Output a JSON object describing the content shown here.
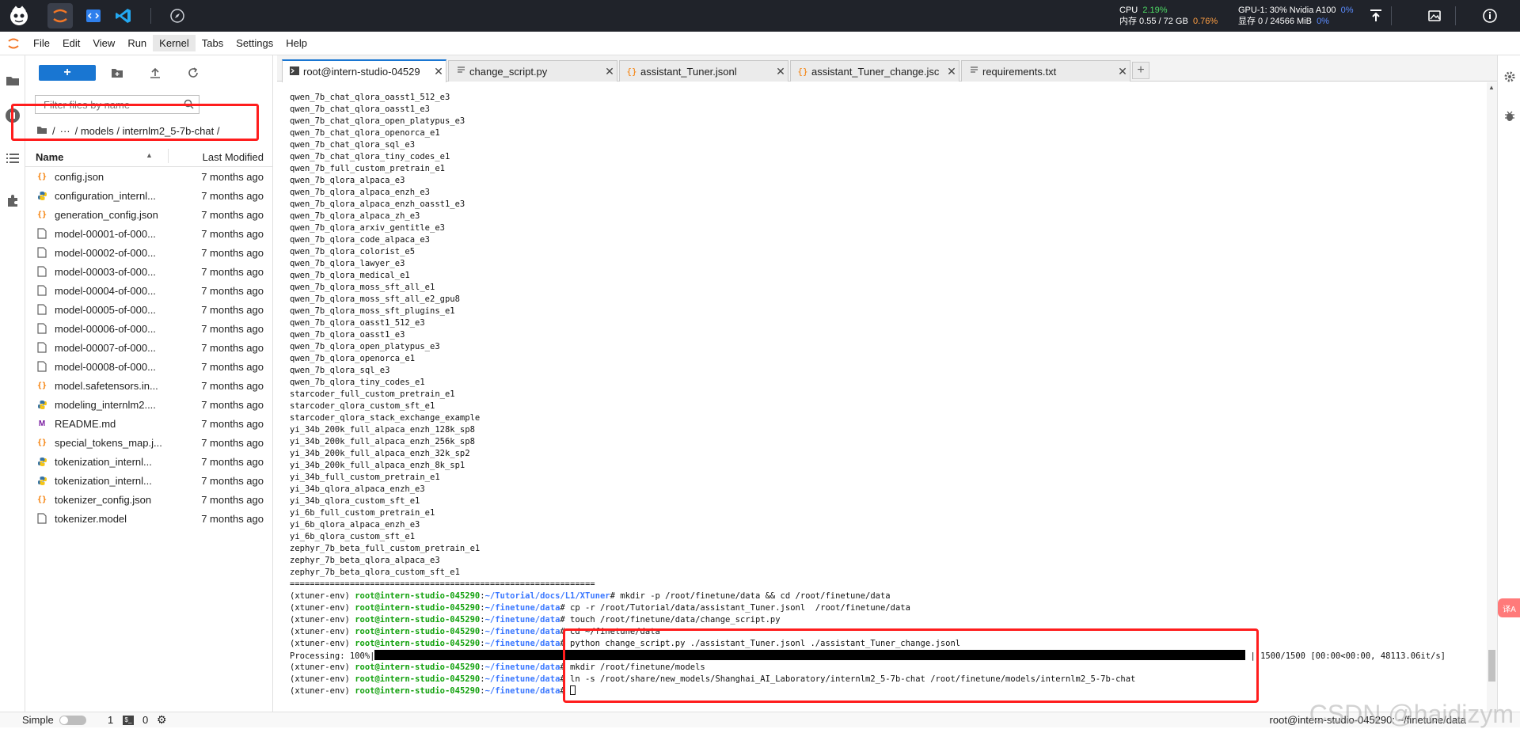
{
  "topbar": {
    "cpu_label": "CPU",
    "cpu_value": "2.19%",
    "mem_label": "内存 0.55 / 72 GB",
    "mem_value": "0.76%",
    "gpu_label": "GPU-1: 30% Nvidia A100",
    "gpu_value": "0%",
    "vram_label": "显存 0 / 24566 MiB",
    "vram_value": "0%",
    "colors": {
      "green": "#4cd964",
      "orange": "#ff9f43",
      "blue": "#5b8cff"
    }
  },
  "menu": {
    "items": [
      "File",
      "Edit",
      "View",
      "Run",
      "Kernel",
      "Tabs",
      "Settings",
      "Help"
    ],
    "active": "Kernel"
  },
  "filebrowser": {
    "new_label": "+",
    "search_placeholder": "Filter files by name",
    "breadcrumb": [
      "/",
      "···",
      "/ models / internlm2_5-7b-chat /"
    ],
    "header_name": "Name",
    "header_modified": "Last Modified",
    "files": [
      {
        "name": "config.json",
        "icon": "json-icon",
        "modified": "7 months ago"
      },
      {
        "name": "configuration_internl...",
        "icon": "python-icon",
        "modified": "7 months ago"
      },
      {
        "name": "generation_config.json",
        "icon": "json-icon",
        "modified": "7 months ago"
      },
      {
        "name": "model-00001-of-000...",
        "icon": "file-icon",
        "modified": "7 months ago"
      },
      {
        "name": "model-00002-of-000...",
        "icon": "file-icon",
        "modified": "7 months ago"
      },
      {
        "name": "model-00003-of-000...",
        "icon": "file-icon",
        "modified": "7 months ago"
      },
      {
        "name": "model-00004-of-000...",
        "icon": "file-icon",
        "modified": "7 months ago"
      },
      {
        "name": "model-00005-of-000...",
        "icon": "file-icon",
        "modified": "7 months ago"
      },
      {
        "name": "model-00006-of-000...",
        "icon": "file-icon",
        "modified": "7 months ago"
      },
      {
        "name": "model-00007-of-000...",
        "icon": "file-icon",
        "modified": "7 months ago"
      },
      {
        "name": "model-00008-of-000...",
        "icon": "file-icon",
        "modified": "7 months ago"
      },
      {
        "name": "model.safetensors.in...",
        "icon": "json-icon",
        "modified": "7 months ago"
      },
      {
        "name": "modeling_internlm2....",
        "icon": "python-icon",
        "modified": "7 months ago"
      },
      {
        "name": "README.md",
        "icon": "markdown-icon",
        "modified": "7 months ago"
      },
      {
        "name": "special_tokens_map.j...",
        "icon": "json-icon",
        "modified": "7 months ago"
      },
      {
        "name": "tokenization_internl...",
        "icon": "python-icon",
        "modified": "7 months ago"
      },
      {
        "name": "tokenization_internl...",
        "icon": "python-icon",
        "modified": "7 months ago"
      },
      {
        "name": "tokenizer_config.json",
        "icon": "json-icon",
        "modified": "7 months ago"
      },
      {
        "name": "tokenizer.model",
        "icon": "file-icon",
        "modified": "7 months ago"
      }
    ]
  },
  "tabs": [
    {
      "label": "root@intern-studio-04529",
      "icon": "terminal-icon",
      "active": true
    },
    {
      "label": "change_script.py",
      "icon": "text-icon",
      "active": false
    },
    {
      "label": "assistant_Tuner.jsonl",
      "icon": "json-icon",
      "active": false
    },
    {
      "label": "assistant_Tuner_change.jsc",
      "icon": "json-icon",
      "active": false
    },
    {
      "label": "requirements.txt",
      "icon": "text-icon",
      "active": false
    }
  ],
  "terminal": {
    "plain_lines": [
      "qwen_7b_chat_qlora_oasst1_512_e3",
      "qwen_7b_chat_qlora_oasst1_e3",
      "qwen_7b_chat_qlora_open_platypus_e3",
      "qwen_7b_chat_qlora_openorca_e1",
      "qwen_7b_chat_qlora_sql_e3",
      "qwen_7b_chat_qlora_tiny_codes_e1",
      "qwen_7b_full_custom_pretrain_e1",
      "qwen_7b_qlora_alpaca_e3",
      "qwen_7b_qlora_alpaca_enzh_e3",
      "qwen_7b_qlora_alpaca_enzh_oasst1_e3",
      "qwen_7b_qlora_alpaca_zh_e3",
      "qwen_7b_qlora_arxiv_gentitle_e3",
      "qwen_7b_qlora_code_alpaca_e3",
      "qwen_7b_qlora_colorist_e5",
      "qwen_7b_qlora_lawyer_e3",
      "qwen_7b_qlora_medical_e1",
      "qwen_7b_qlora_moss_sft_all_e1",
      "qwen_7b_qlora_moss_sft_all_e2_gpu8",
      "qwen_7b_qlora_moss_sft_plugins_e1",
      "qwen_7b_qlora_oasst1_512_e3",
      "qwen_7b_qlora_oasst1_e3",
      "qwen_7b_qlora_open_platypus_e3",
      "qwen_7b_qlora_openorca_e1",
      "qwen_7b_qlora_sql_e3",
      "qwen_7b_qlora_tiny_codes_e1",
      "starcoder_full_custom_pretrain_e1",
      "starcoder_qlora_custom_sft_e1",
      "starcoder_qlora_stack_exchange_example",
      "yi_34b_200k_full_alpaca_enzh_128k_sp8",
      "yi_34b_200k_full_alpaca_enzh_256k_sp8",
      "yi_34b_200k_full_alpaca_enzh_32k_sp2",
      "yi_34b_200k_full_alpaca_enzh_8k_sp1",
      "yi_34b_full_custom_pretrain_e1",
      "yi_34b_qlora_alpaca_enzh_e3",
      "yi_34b_qlora_custom_sft_e1",
      "yi_6b_full_custom_pretrain_e1",
      "yi_6b_qlora_alpaca_enzh_e3",
      "yi_6b_qlora_custom_sft_e1",
      "zephyr_7b_beta_full_custom_pretrain_e1",
      "zephyr_7b_beta_qlora_alpaca_e3",
      "zephyr_7b_beta_qlora_custom_sft_e1",
      "============================================================="
    ],
    "env": "(xtuner-env) ",
    "user": "root@intern-studio-045290",
    "commands": [
      {
        "path": "~/Tutorial/docs/L1/XTuner",
        "cmd": "mkdir -p /root/finetune/data && cd /root/finetune/data"
      },
      {
        "path": "~/finetune/data",
        "cmd": "cp -r /root/Tutorial/data/assistant_Tuner.jsonl  /root/finetune/data"
      },
      {
        "path": "~/finetune/data",
        "cmd": "touch /root/finetune/data/change_script.py"
      },
      {
        "path": "~/finetune/data",
        "cmd": "cd ~/finetune/data"
      },
      {
        "path": "~/finetune/data",
        "cmd": "python change_script.py ./assistant_Tuner.jsonl ./assistant_Tuner_change.jsonl"
      }
    ],
    "progress_prefix": "Processing: 100%|",
    "progress_suffix": "| 1500/1500 [00:00<00:00, 48113.06it/s]",
    "progress_fraction": 1.0,
    "commands_after": [
      {
        "path": "~/finetune/data",
        "cmd": "mkdir /root/finetune/models"
      },
      {
        "path": "~/finetune/data",
        "cmd": "ln -s /root/share/new_models/Shanghai_AI_Laboratory/internlm2_5-7b-chat /root/finetune/models/internlm2_5-7b-chat"
      }
    ],
    "last_prompt_path": "~/finetune/data"
  },
  "statusbar": {
    "mode_label": "Simple",
    "kernels_count": "1",
    "terminals_count": "0",
    "path_text": "root@intern-studio-045290: ~/finetune/data",
    "watermark": "CSDN @haidizym"
  }
}
